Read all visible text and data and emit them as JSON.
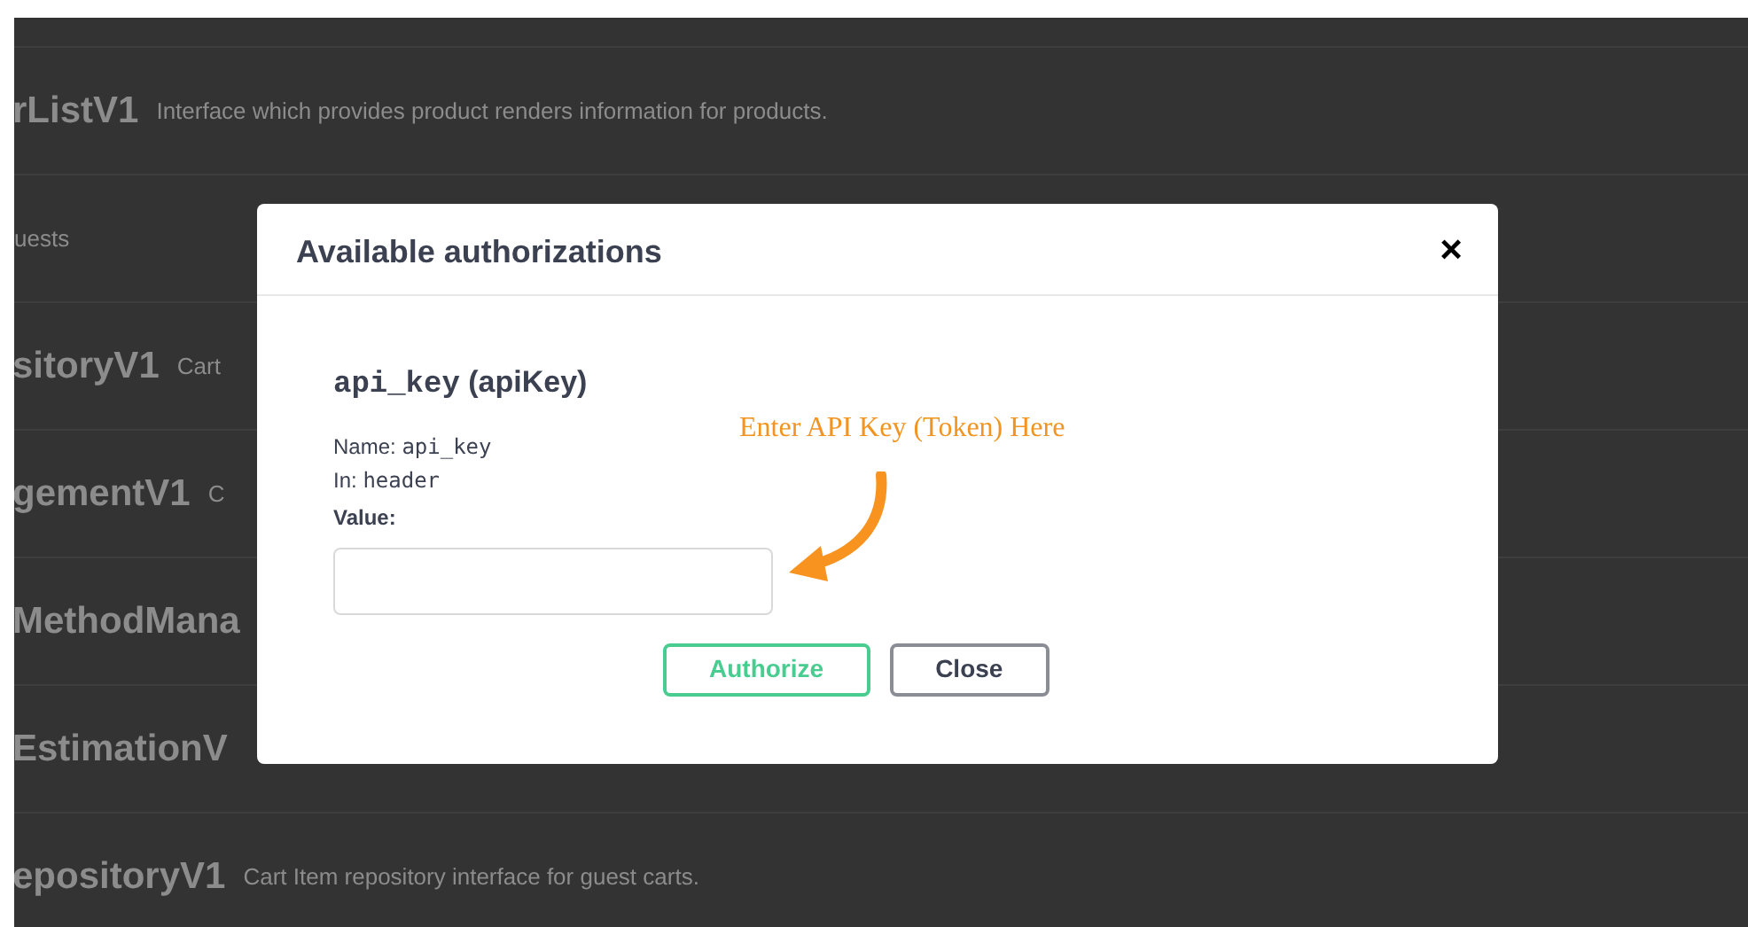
{
  "background_rows": [
    {},
    {
      "title": "rListV1",
      "description": "Interface which provides product renders information for products."
    },
    {
      "description": "uests"
    },
    {
      "title": "sitoryV1",
      "description": "Cart"
    },
    {
      "title": "gementV1",
      "description": "C"
    },
    {
      "title": "MethodMana"
    },
    {
      "title": "EstimationV"
    },
    {
      "title": "epositoryV1",
      "description": "Cart Item repository interface for guest carts."
    }
  ],
  "dialog": {
    "title": "Available authorizations",
    "close": "×",
    "scheme": {
      "name": "api_key",
      "type": "(apiKey)"
    },
    "fields": [
      {
        "label": "Name:",
        "value": "api_key"
      },
      {
        "label": "In:",
        "value": "header"
      }
    ],
    "value_label": "Value:",
    "buttons": [
      {
        "label": "Authorize",
        "kind": "primary"
      },
      {
        "label": "Close",
        "kind": "secondary"
      }
    ]
  },
  "annotation": {
    "text": "Enter API Key (Token) Here"
  }
}
